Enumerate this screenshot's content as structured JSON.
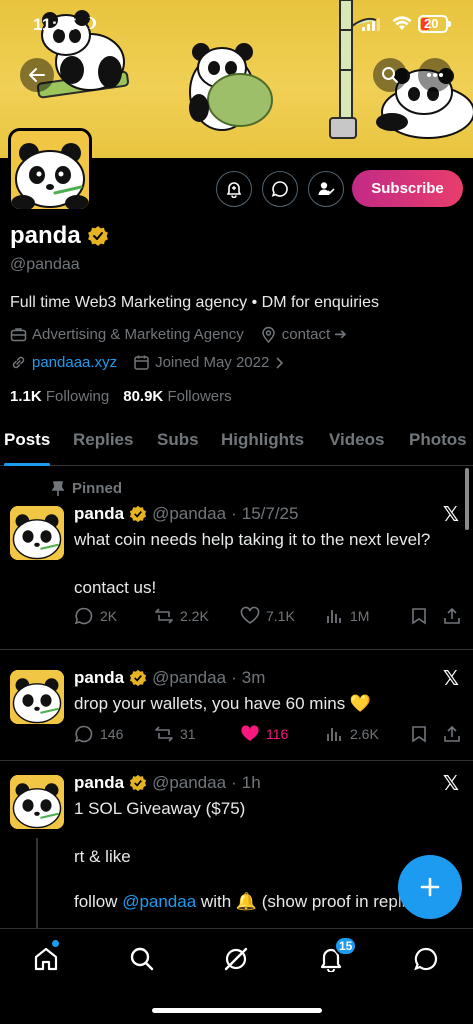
{
  "status_bar": {
    "time": "11:35",
    "battery": "20"
  },
  "profile": {
    "name": "panda",
    "handle": "@pandaa",
    "bio": "Full time Web3 Marketing agency • DM for enquiries",
    "category": "Advertising & Marketing Agency",
    "location": "contact ➔",
    "website": "pandaaa.xyz",
    "joined": "Joined May 2022",
    "following_count": "1.1K",
    "following_label": "Following",
    "followers_count": "80.9K",
    "followers_label": "Followers",
    "subscribe_label": "Subscribe",
    "verified_color": "#e6b422"
  },
  "tabs": [
    "Posts",
    "Replies",
    "Subs",
    "Highlights",
    "Videos",
    "Photos"
  ],
  "posts": [
    {
      "pinned_label": "Pinned",
      "name": "panda",
      "handle": "@pandaa",
      "time": "15/7/25",
      "line1": "what coin needs help taking it to the next level?",
      "line2": "contact us!",
      "replies": "2K",
      "reposts": "2.2K",
      "likes": "7.1K",
      "views": "1M"
    },
    {
      "name": "panda",
      "handle": "@pandaa",
      "time": "3m",
      "line1": "drop your wallets, you have 60 mins 💛",
      "replies": "146",
      "reposts": "31",
      "likes": "116",
      "views": "2.6K",
      "like_color": "#f91880"
    },
    {
      "name": "panda",
      "handle": "@pandaa",
      "time": "1h",
      "line1": "1 SOL Giveaway ($75)",
      "line2": "rt & like",
      "line3_pre": "follow ",
      "line3_mention": "@pandaa",
      "line3_post": " with 🔔 (show proof in replies)"
    }
  ],
  "nav": {
    "notifications_badge": "15"
  },
  "colors": {
    "accent": "#1d9bf0",
    "banner": "#f0d055",
    "subscribe": "#d6336f"
  }
}
